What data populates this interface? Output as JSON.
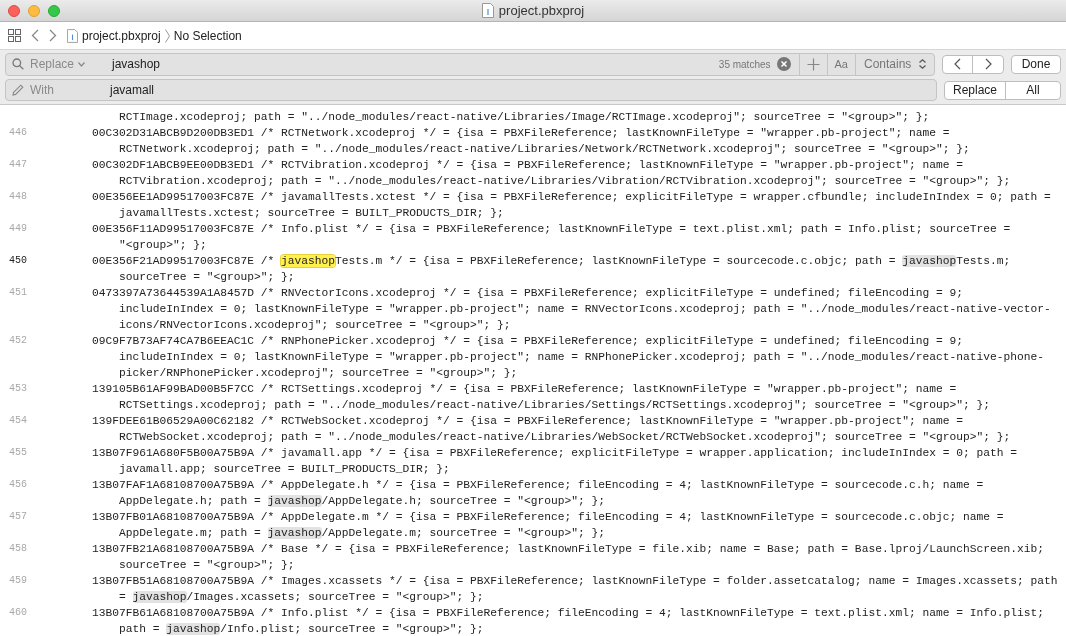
{
  "window": {
    "title": "project.pbxproj"
  },
  "jump_bar": {
    "file": "project.pbxproj",
    "selection": "No Selection"
  },
  "find": {
    "mode": "Replace",
    "query": "javashop",
    "match_count": "35 matches",
    "case_button": "Aa",
    "match_type": "Contains",
    "done": "Done"
  },
  "replace": {
    "label": "With",
    "value": "javamall",
    "buttons": [
      "Replace",
      "All"
    ]
  },
  "code_lines": [
    {
      "rows": [
        [
          "RCTImage.xcodeproj; path = \"../node_modules/react-native/Libraries/Image/RCTImage.xcodeproj\"; sourceTree = \"<group>\"; };"
        ]
      ]
    },
    {
      "number": "446",
      "current": false,
      "rows": [
        [
          "00C302D31ABCB9D200DB3ED1 /* RCTNetwork.xcodeproj */ = {isa = PBXFileReference; lastKnownFileType = \"wrapper.pb-project\"; name ="
        ],
        [
          "RCTNetwork.xcodeproj; path = \"../node_modules/react-native/Libraries/Network/RCTNetwork.xcodeproj\"; sourceTree = \"<group>\"; };"
        ]
      ]
    },
    {
      "number": "447",
      "current": false,
      "rows": [
        [
          "00C302DF1ABCB9EE00DB3ED1 /* RCTVibration.xcodeproj */ = {isa = PBXFileReference; lastKnownFileType = \"wrapper.pb-project\"; name ="
        ],
        [
          "RCTVibration.xcodeproj; path = \"../node_modules/react-native/Libraries/Vibration/RCTVibration.xcodeproj\"; sourceTree = \"<group>\"; };"
        ]
      ]
    },
    {
      "number": "448",
      "current": false,
      "rows": [
        [
          "00E356EE1AD99517003FC87E /* javamallTests.xctest */ = {isa = PBXFileReference; explicitFileType = wrapper.cfbundle; includeInIndex = 0; path ="
        ],
        [
          "javamallTests.xctest; sourceTree = BUILT_PRODUCTS_DIR; };"
        ]
      ]
    },
    {
      "number": "449",
      "current": false,
      "rows": [
        [
          "00E356F11AD99517003FC87E /* Info.plist */ = {isa = PBXFileReference; lastKnownFileType = text.plist.xml; path = Info.plist; sourceTree ="
        ],
        [
          "\"<group>\"; };"
        ]
      ]
    },
    {
      "number": "450",
      "current": true,
      "rows": [
        [
          "00E356F21AD99517003FC87E /* ",
          {
            "text": "javashop",
            "current": true
          },
          "Tests.m */ = {isa = PBXFileReference; lastKnownFileType = sourcecode.c.objc; path = ",
          {
            "text": "javashop",
            "current": false
          },
          "Tests.m;"
        ],
        [
          "sourceTree = \"<group>\"; };"
        ]
      ]
    },
    {
      "number": "451",
      "current": false,
      "rows": [
        [
          "0473397A73644539A1A8457D /* RNVectorIcons.xcodeproj */ = {isa = PBXFileReference; explicitFileType = undefined; fileEncoding = 9;"
        ],
        [
          "includeInIndex = 0; lastKnownFileType = \"wrapper.pb-project\"; name = RNVectorIcons.xcodeproj; path = \"../node_modules/react-native-vector-"
        ],
        [
          "icons/RNVectorIcons.xcodeproj\"; sourceTree = \"<group>\"; };"
        ]
      ]
    },
    {
      "number": "452",
      "current": false,
      "rows": [
        [
          "09C9F7B73AF74CA7B6EEAC1C /* RNPhonePicker.xcodeproj */ = {isa = PBXFileReference; explicitFileType = undefined; fileEncoding = 9;"
        ],
        [
          "includeInIndex = 0; lastKnownFileType = \"wrapper.pb-project\"; name = RNPhonePicker.xcodeproj; path = \"../node_modules/react-native-phone-"
        ],
        [
          "picker/RNPhonePicker.xcodeproj\"; sourceTree = \"<group>\"; };"
        ]
      ]
    },
    {
      "number": "453",
      "current": false,
      "rows": [
        [
          "139105B61AF99BAD00B5F7CC /* RCTSettings.xcodeproj */ = {isa = PBXFileReference; lastKnownFileType = \"wrapper.pb-project\"; name ="
        ],
        [
          "RCTSettings.xcodeproj; path = \"../node_modules/react-native/Libraries/Settings/RCTSettings.xcodeproj\"; sourceTree = \"<group>\"; };"
        ]
      ]
    },
    {
      "number": "454",
      "current": false,
      "rows": [
        [
          "139FDEE61B06529A00C62182 /* RCTWebSocket.xcodeproj */ = {isa = PBXFileReference; lastKnownFileType = \"wrapper.pb-project\"; name ="
        ],
        [
          "RCTWebSocket.xcodeproj; path = \"../node_modules/react-native/Libraries/WebSocket/RCTWebSocket.xcodeproj\"; sourceTree = \"<group>\"; };"
        ]
      ]
    },
    {
      "number": "455",
      "current": false,
      "rows": [
        [
          "13B07F961A680F5B00A75B9A /* javamall.app */ = {isa = PBXFileReference; explicitFileType = wrapper.application; includeInIndex = 0; path ="
        ],
        [
          "javamall.app; sourceTree = BUILT_PRODUCTS_DIR; };"
        ]
      ]
    },
    {
      "number": "456",
      "current": false,
      "rows": [
        [
          "13B07FAF1A68108700A75B9A /* AppDelegate.h */ = {isa = PBXFileReference; fileEncoding = 4; lastKnownFileType = sourcecode.c.h; name ="
        ],
        [
          "AppDelegate.h; path = ",
          {
            "text": "javashop",
            "current": false
          },
          "/AppDelegate.h; sourceTree = \"<group>\"; };"
        ]
      ]
    },
    {
      "number": "457",
      "current": false,
      "rows": [
        [
          "13B07FB01A68108700A75B9A /* AppDelegate.m */ = {isa = PBXFileReference; fileEncoding = 4; lastKnownFileType = sourcecode.c.objc; name ="
        ],
        [
          "AppDelegate.m; path = ",
          {
            "text": "javashop",
            "current": false
          },
          "/AppDelegate.m; sourceTree = \"<group>\"; };"
        ]
      ]
    },
    {
      "number": "458",
      "current": false,
      "rows": [
        [
          "13B07FB21A68108700A75B9A /* Base */ = {isa = PBXFileReference; lastKnownFileType = file.xib; name = Base; path = Base.lproj/LaunchScreen.xib;"
        ],
        [
          "sourceTree = \"<group>\"; };"
        ]
      ]
    },
    {
      "number": "459",
      "current": false,
      "rows": [
        [
          "13B07FB51A68108700A75B9A /* Images.xcassets */ = {isa = PBXFileReference; lastKnownFileType = folder.assetcatalog; name = Images.xcassets; path"
        ],
        [
          "= ",
          {
            "text": "javashop",
            "current": false
          },
          "/Images.xcassets; sourceTree = \"<group>\"; };"
        ]
      ]
    },
    {
      "number": "460",
      "current": false,
      "rows": [
        [
          "13B07FB61A68108700A75B9A /* Info.plist */ = {isa = PBXFileReference; fileEncoding = 4; lastKnownFileType = text.plist.xml; name = Info.plist;"
        ],
        [
          "path = ",
          {
            "text": "javashop",
            "current": false
          },
          "/Info.plist; sourceTree = \"<group>\"; };"
        ]
      ]
    }
  ]
}
